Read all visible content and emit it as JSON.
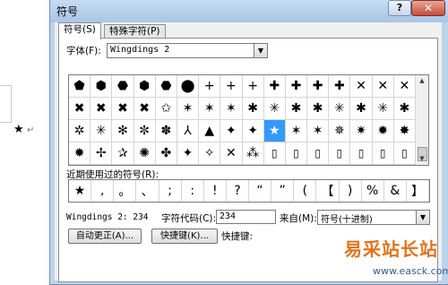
{
  "dialog": {
    "title": "符号",
    "help_label": "?",
    "close_label": "✕"
  },
  "tabs": [
    {
      "label": "符号(S)",
      "active": true
    },
    {
      "label": "特殊字符(P)",
      "active": false
    }
  ],
  "font": {
    "label": "字体(F):",
    "value": "Wingdings 2"
  },
  "symbol_grid": {
    "rows": [
      [
        "⬟",
        "⬢",
        "⬣",
        "⬢",
        "⬣",
        "⬤",
        "+",
        "+",
        "+",
        "✚",
        "✚",
        "✚",
        "✚",
        "✕",
        "✕",
        "✕"
      ],
      [
        "✖",
        "✖",
        "✖",
        "✖",
        "✩",
        "✶",
        "✶",
        "✶",
        "✱",
        "✳",
        "✱",
        "✱",
        "✳",
        "✱",
        "✳",
        "✱"
      ],
      [
        "✲",
        "✳",
        "✻",
        "✼",
        "✽",
        "⅄",
        "▲",
        "✦",
        "✦",
        "★",
        "✶",
        "✶",
        "✵",
        "✷",
        "✹",
        "✸"
      ],
      [
        "✹",
        "✢",
        "✰",
        "✺",
        "✤",
        "✦",
        "✧",
        "✕",
        "⁂",
        "▯",
        "▯",
        "▯",
        "▯",
        "▯",
        "▯",
        "▯"
      ]
    ],
    "selected_char": "★"
  },
  "recent": {
    "label": "近期使用过的符号(R):",
    "symbols": [
      "★",
      ",",
      "。",
      "、",
      ";",
      ":",
      "!",
      "?",
      "“",
      "”",
      "(",
      "【",
      ")",
      "%",
      "&",
      "】"
    ]
  },
  "status": {
    "font_code": "Wingdings 2: 234",
    "char_code_label": "字符代码(C):",
    "char_code_value": "234",
    "from_label": "来自(M):",
    "from_value": "符号(十进制)"
  },
  "buttons": {
    "autocorrect": "自动更正(A)...",
    "shortcut_key": "快捷键(K)...",
    "shortcut_label": "快捷键:"
  },
  "background": {
    "doc_symbol": "★",
    "para_mark": "↵"
  },
  "watermark": {
    "title": "易采站长站",
    "url": "www.easck.com"
  }
}
